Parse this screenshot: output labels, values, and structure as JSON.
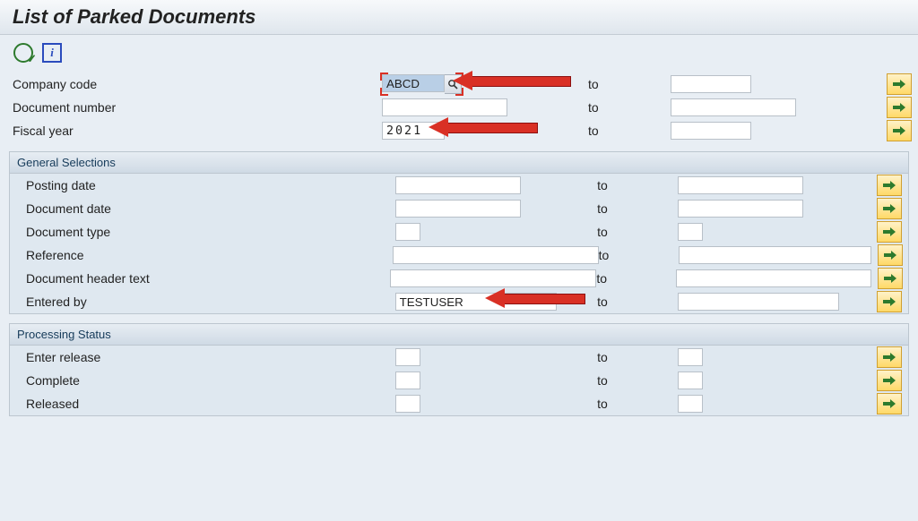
{
  "title": "List of Parked Documents",
  "top": {
    "company_code": {
      "label": "Company code",
      "from": "ABCD",
      "to": "",
      "to_label": "to"
    },
    "document_number": {
      "label": "Document number",
      "from": "",
      "to": "",
      "to_label": "to"
    },
    "fiscal_year": {
      "label": "Fiscal year",
      "from": "2021",
      "to": "",
      "to_label": "to"
    }
  },
  "general": {
    "title": "General Selections",
    "posting_date": {
      "label": "Posting date",
      "from": "",
      "to": "",
      "to_label": "to"
    },
    "document_date": {
      "label": "Document date",
      "from": "",
      "to": "",
      "to_label": "to"
    },
    "document_type": {
      "label": "Document type",
      "from": "",
      "to": "",
      "to_label": "to"
    },
    "reference": {
      "label": "Reference",
      "from": "",
      "to": "",
      "to_label": "to"
    },
    "header_text": {
      "label": "Document header text",
      "from": "",
      "to": "",
      "to_label": "to"
    },
    "entered_by": {
      "label": "Entered by",
      "from": "TESTUSER",
      "to": "",
      "to_label": "to"
    }
  },
  "status": {
    "title": "Processing Status",
    "enter_release": {
      "label": "Enter release",
      "from": "",
      "to": "",
      "to_label": "to"
    },
    "complete": {
      "label": "Complete",
      "from": "",
      "to": "",
      "to_label": "to"
    },
    "released": {
      "label": "Released",
      "from": "",
      "to": "",
      "to_label": "to"
    }
  },
  "icons": {
    "info": "i"
  }
}
